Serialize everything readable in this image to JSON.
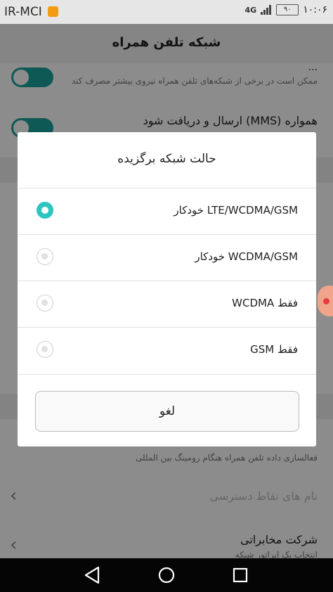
{
  "status_bar": {
    "carrier": "IR-MCI",
    "network": "4G",
    "battery": "۹۰",
    "time": "۱۰:۰۶"
  },
  "header": {
    "title": "شبکه تلفن همراه"
  },
  "background": {
    "row1_title": "...",
    "row1_sub": "ممکن است در برخی از شبکه‌های تلفن همراه نیروی بیشتر مصرف کند",
    "row2_title": "همواره (MMS) ارسال و دریافت شود",
    "row3_sub": "فعالسازی داده تلفن همراه هنگام رومینگ بین المللی",
    "row4_title": "نام های نقاط دسترسی",
    "row5_title": "شرکت مخابراتی",
    "row5_sub": "انتخاب یک اپراتور شبکه"
  },
  "dialog": {
    "title": "حالت شبکه برگزیده",
    "options": [
      {
        "label": "LTE/WCDMA/GSM خودکار",
        "selected": true
      },
      {
        "label": "WCDMA/GSM خودکار",
        "selected": false
      },
      {
        "label": "فقط WCDMA",
        "selected": false
      },
      {
        "label": "فقط GSM",
        "selected": false
      }
    ],
    "cancel_label": "لغو"
  },
  "colors": {
    "accent": "#2ec4c0",
    "toggle": "#1aa39b"
  }
}
